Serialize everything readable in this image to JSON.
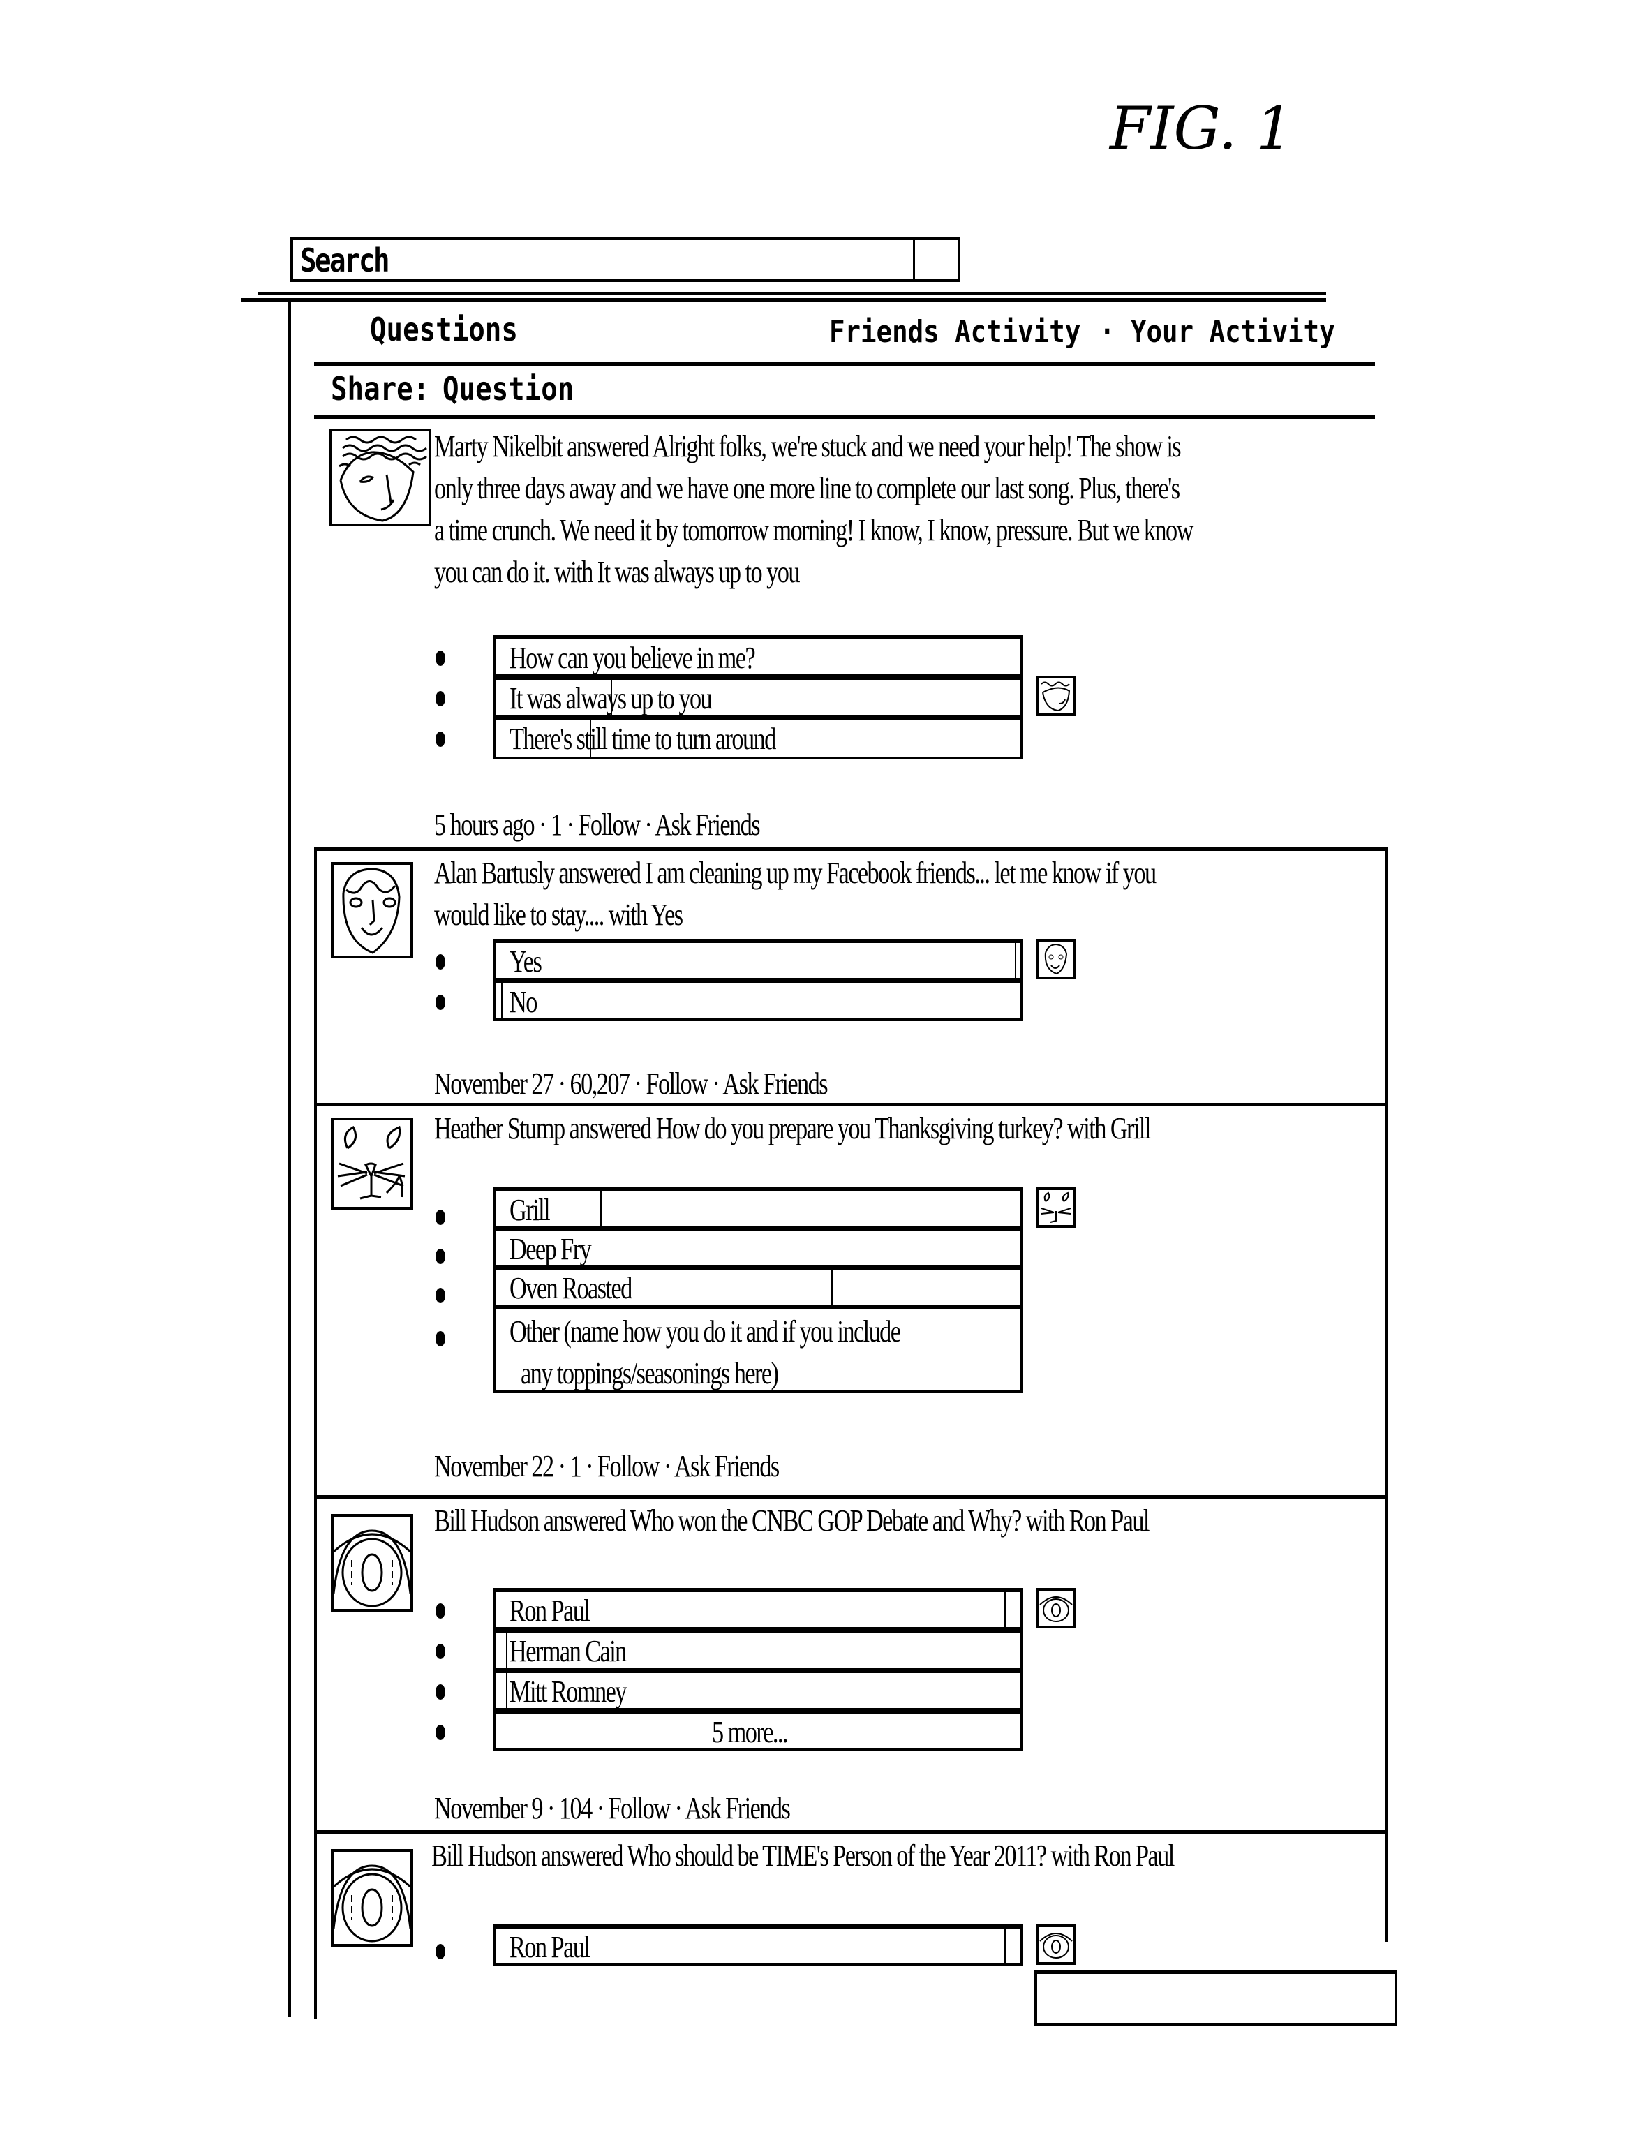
{
  "figure_label": "FIG. 1",
  "search": {
    "label": "Search"
  },
  "header": {
    "title": "Questions",
    "tabs": [
      {
        "label": "Friends Activity"
      },
      {
        "label": "Your Activity"
      }
    ],
    "separator": "·"
  },
  "share": {
    "label": "Share:",
    "action": "Question"
  },
  "feed": [
    {
      "avatar": "wavy-hair-face-avatar",
      "text_lines": [
        "Marty Nikelbit answered Alright folks, we're stuck and we need your help! The show is",
        "only three days away and we have one more line to complete our last song. Plus, there's",
        "a time crunch. We need it by tomorrow morning! I know, I know, pressure. But we know",
        "you can do it.  with  It was always up to you"
      ],
      "options": [
        {
          "label": "How can you believe in me?",
          "fill": 0.0
        },
        {
          "label": "It was always up to you",
          "fill": 0.22
        },
        {
          "label": "There's still time to turn around",
          "fill": 0.18
        }
      ],
      "meta": {
        "time": "5 hours ago",
        "count": "1",
        "follow": "Follow",
        "ask": "Ask Friends"
      }
    },
    {
      "avatar": "oval-face-avatar",
      "text_lines": [
        "Alan Bartusly answered I am cleaning up my Facebook friends... let me know if you",
        "would like to stay....  with  Yes"
      ],
      "options": [
        {
          "label": "Yes",
          "fill": 0.99
        },
        {
          "label": "No",
          "fill": 0.01
        }
      ],
      "meta": {
        "time": "November 27",
        "count": "60,207",
        "follow": "Follow",
        "ask": "Ask Friends"
      }
    },
    {
      "avatar": "cat-face-avatar",
      "text_lines": [
        "Heather Stump answered How do you prepare you Thanksgiving turkey?  with  Grill"
      ],
      "options": [
        {
          "label": "Grill",
          "fill": 0.2
        },
        {
          "label": "Deep Fry",
          "fill": 0.0
        },
        {
          "label": "Oven Roasted",
          "fill": 0.64
        },
        {
          "label": "Other (name how you do it and if you include",
          "label2": "any toppings/seasonings here)",
          "fill": 0.0
        }
      ],
      "meta": {
        "time": "November 22",
        "count": "1",
        "follow": "Follow",
        "ask": "Ask Friends"
      }
    },
    {
      "avatar": "eye-avatar",
      "text_lines": [
        "Bill Hudson  answered  Who won the CNBC GOP Debate and Why?  with  Ron Paul"
      ],
      "options": [
        {
          "label": "Ron Paul",
          "fill": 0.97
        },
        {
          "label": "Herman Cain",
          "fill": 0.02
        },
        {
          "label": "Mitt Romney",
          "fill": 0.02
        },
        {
          "label": "5 more...",
          "fill": 0.0
        }
      ],
      "meta": {
        "time": "November 9",
        "count": "104",
        "follow": "Follow",
        "ask": "Ask Friends"
      }
    },
    {
      "avatar": "eye-avatar",
      "text_lines": [
        "Bill Hudson  answered  Who should be TIME's Person of the Year 2011?  with  Ron Paul"
      ],
      "options": [
        {
          "label": "Ron Paul",
          "fill": 0.97
        }
      ]
    }
  ]
}
